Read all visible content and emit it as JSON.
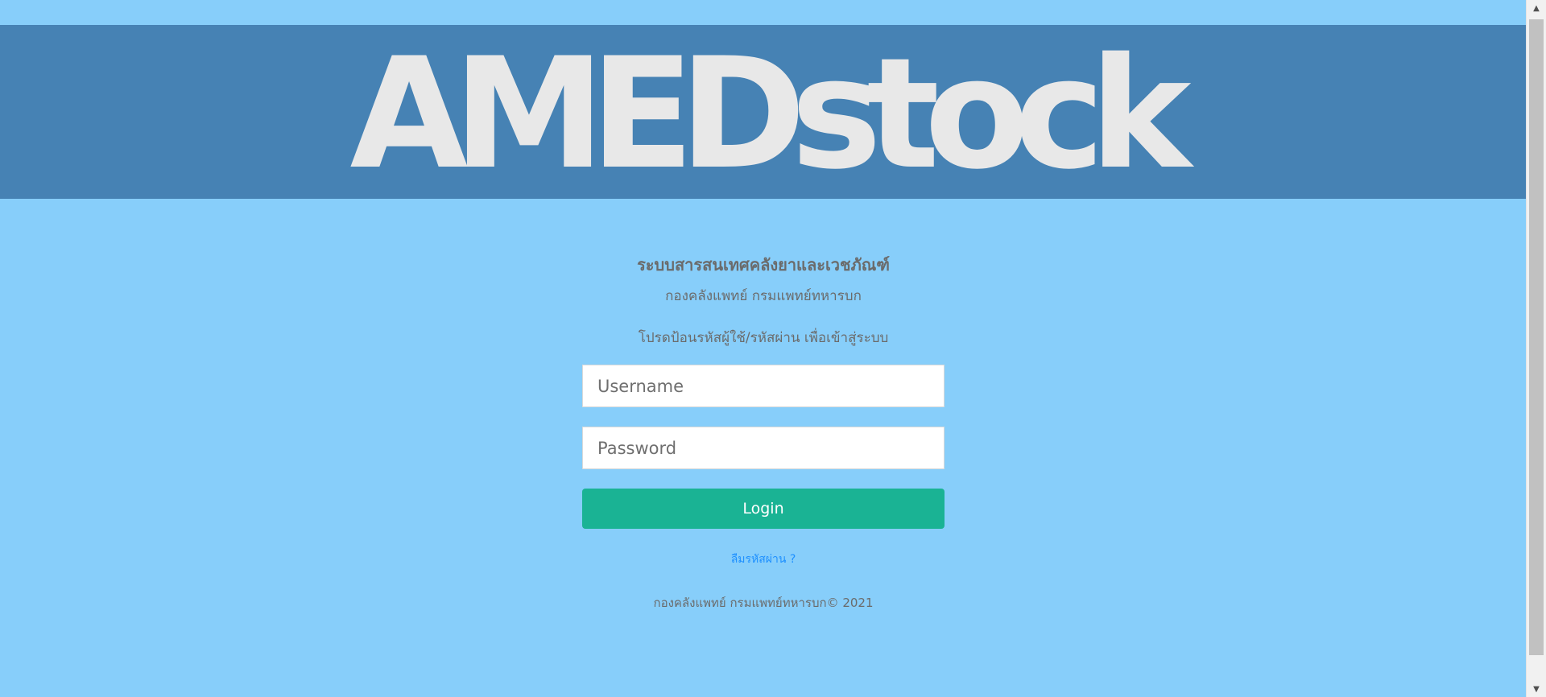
{
  "header": {
    "brand": "AMEDstock"
  },
  "intro": {
    "system_title": "ระบบสารสนเทศคลังยาและเวชภัณฑ์",
    "organization": "กองคลังแพทย์ กรมแพทย์ทหารบก",
    "instruction": "โปรดป้อนรหัสผู้ใช้/รหัสผ่าน เพื่อเข้าสู่ระบบ"
  },
  "form": {
    "username_placeholder": "Username",
    "password_placeholder": "Password",
    "login_label": "Login",
    "forgot_label": "ลืมรหัสผ่าน ?"
  },
  "footer": {
    "text": "กองคลังแพทย์ กรมแพทย์ทหารบก© 2021"
  },
  "colors": {
    "page_background": "#87cefa",
    "banner_background": "#4682b4",
    "brand_text": "#e8e8e8",
    "login_button": "#1ab394",
    "link": "#1e90ff"
  },
  "icons": {
    "scroll_up": "triangle-up-icon",
    "scroll_down": "triangle-down-icon"
  }
}
